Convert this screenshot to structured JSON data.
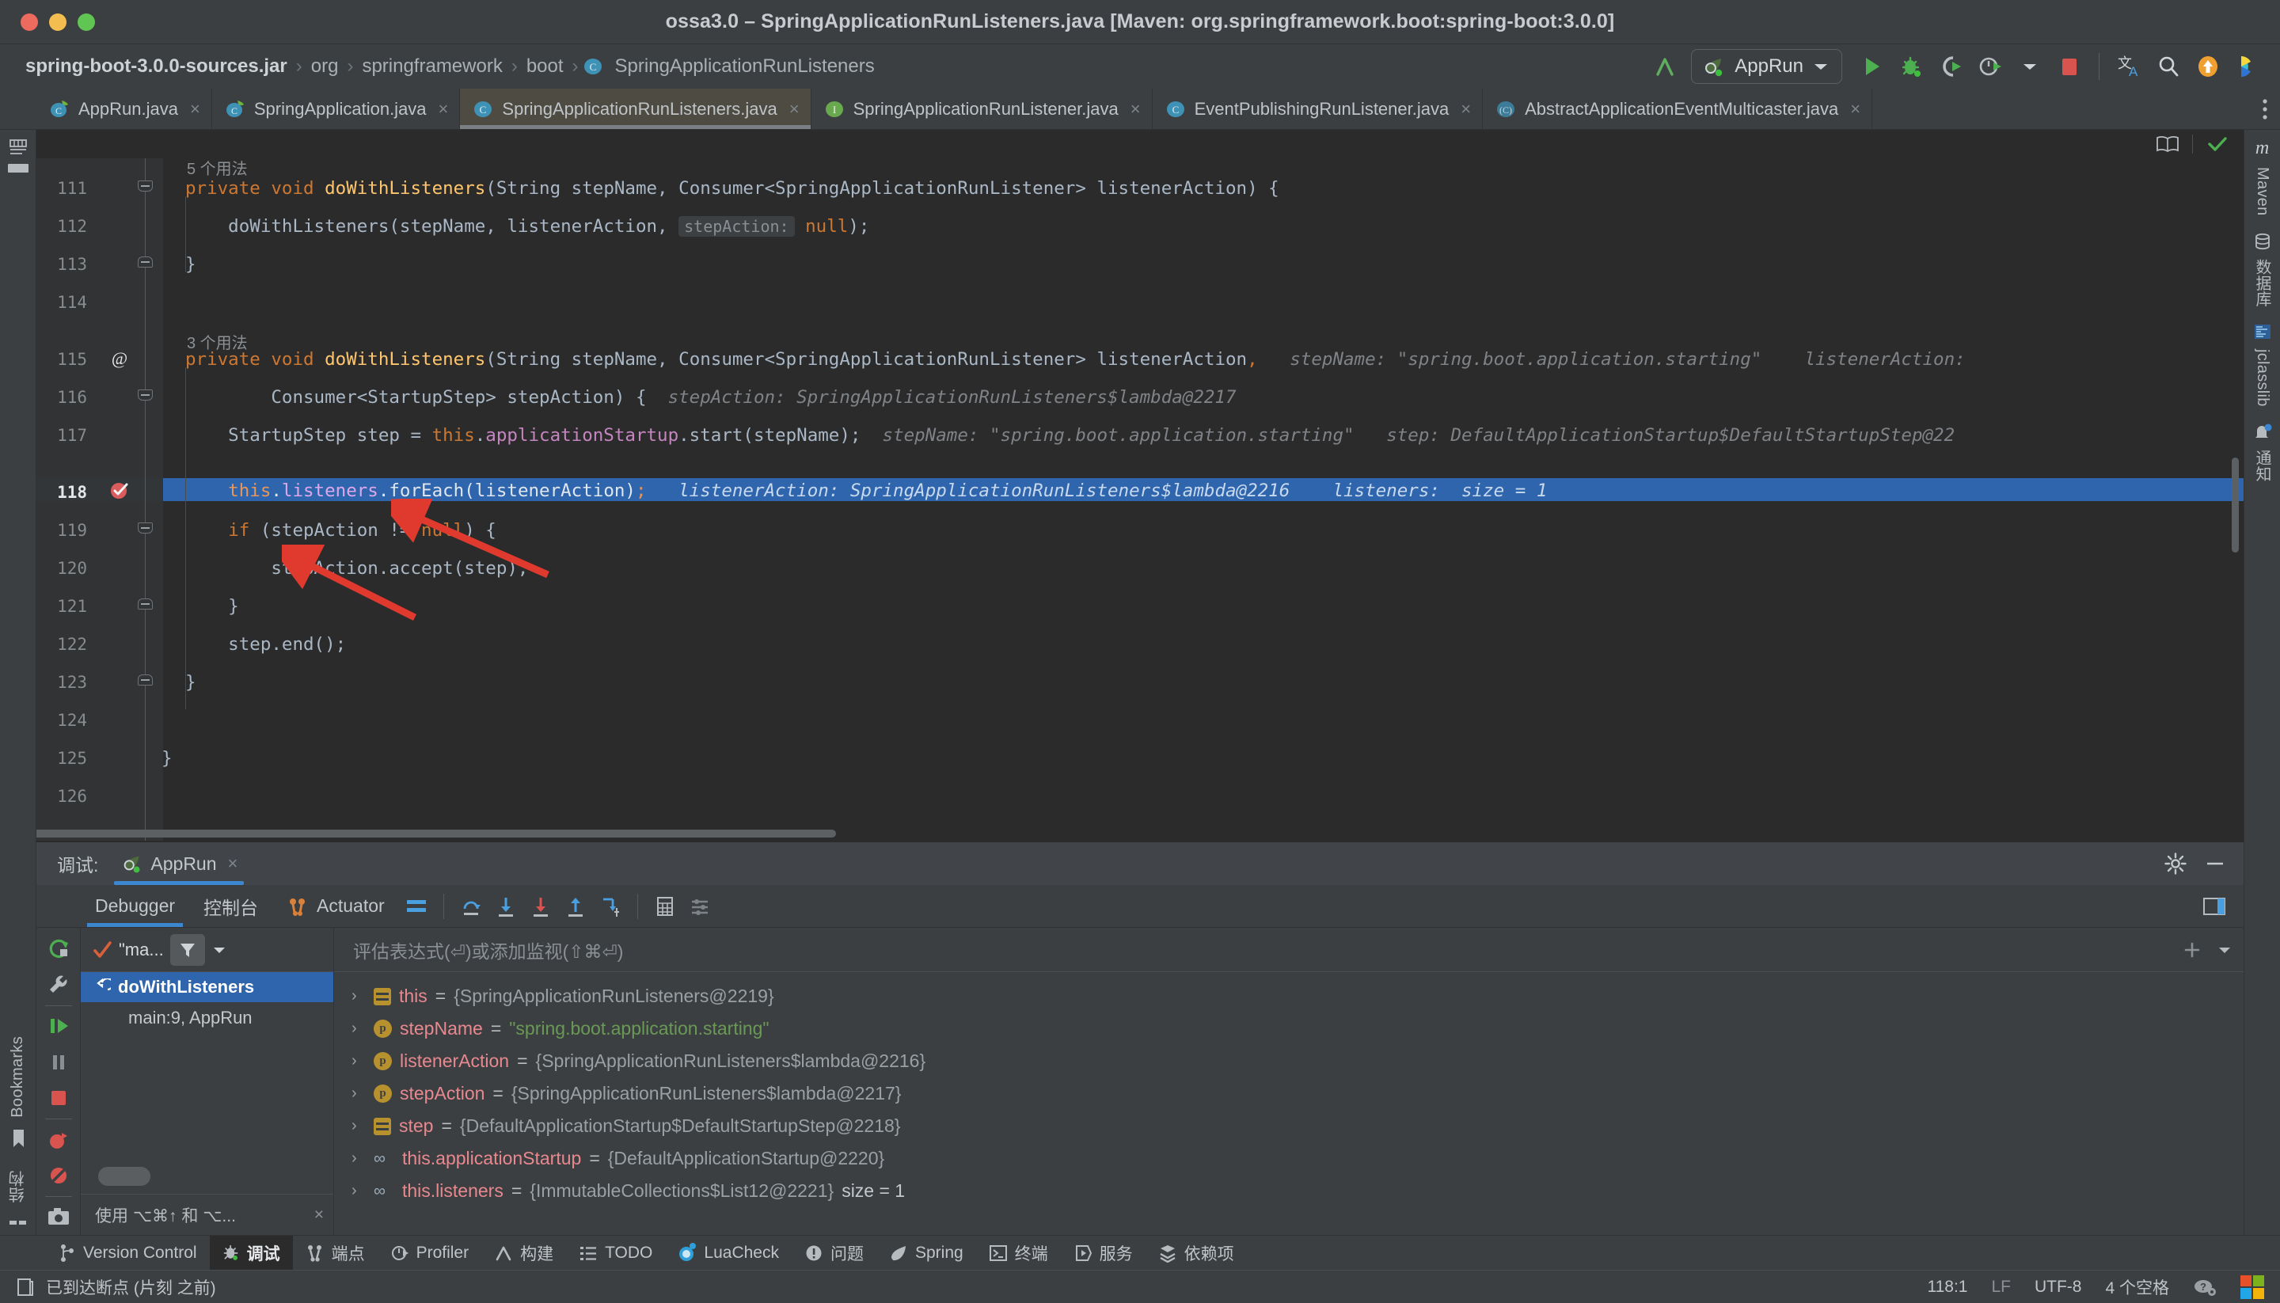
{
  "window": {
    "title": "ossa3.0 – SpringApplicationRunListeners.java [Maven: org.springframework.boot:spring-boot:3.0.0]",
    "traffic": [
      "close",
      "minimize",
      "zoom"
    ]
  },
  "breadcrumbs": [
    {
      "label": "spring-boot-3.0.0-sources.jar",
      "icon": ""
    },
    {
      "label": "org",
      "icon": ""
    },
    {
      "label": "springframework",
      "icon": ""
    },
    {
      "label": "boot",
      "icon": ""
    },
    {
      "label": "SpringApplicationRunListeners",
      "icon": "class-icon"
    }
  ],
  "toolbar": {
    "build_label": "build-icon",
    "run_config": "AppRun",
    "run_label": "run-icon",
    "debug_label": "debug-icon",
    "run_coverage_label": "run-with-coverage-icon",
    "profiler_label": "profiler-icon",
    "stop_label": "stop-icon",
    "translate_label": "translate-icon",
    "search_label": "search-everywhere-icon",
    "update_label": "update-icon",
    "ai_label": "ai-assistant-icon"
  },
  "tabs": [
    {
      "label": "AppRun.java",
      "icon": "spring-class-icon",
      "active": false
    },
    {
      "label": "SpringApplication.java",
      "icon": "class-icon",
      "active": false
    },
    {
      "label": "SpringApplicationRunListeners.java",
      "icon": "class-icon",
      "active": true
    },
    {
      "label": "SpringApplicationRunListener.java",
      "icon": "interface-icon",
      "active": false
    },
    {
      "label": "EventPublishingRunListener.java",
      "icon": "class-icon",
      "active": false
    },
    {
      "label": "AbstractApplicationEventMulticaster.java",
      "icon": "abstract-class-icon",
      "active": false
    }
  ],
  "left_toolwindows": [
    {
      "label": "项目",
      "icon": "project-icon"
    },
    {
      "label": "Bookmarks",
      "icon": "bookmarks-icon"
    },
    {
      "label": "结构",
      "icon": "structure-icon"
    }
  ],
  "right_toolwindows": [
    {
      "label": "Maven",
      "icon": "maven-icon"
    },
    {
      "label": "数据库",
      "icon": "database-icon"
    },
    {
      "label": "jclasslib",
      "icon": "jclasslib-icon"
    },
    {
      "label": "通知",
      "icon": "notifications-icon"
    }
  ],
  "editor": {
    "reader_mode_icon": "reader-mode-icon",
    "inspections_icon": "inspections-ok-icon",
    "usages_5": "5 个用法",
    "usages_3": "3 个用法",
    "line_numbers": [
      "111",
      "112",
      "113",
      "114",
      "115",
      "116",
      "117",
      "118",
      "119",
      "120",
      "121",
      "122",
      "123",
      "124",
      "125",
      "126"
    ],
    "current_line": "118",
    "lines": {
      "l111": "private void doWithListeners(String stepName, Consumer<SpringApplicationRunListener> listenerAction) {",
      "l112": "doWithListeners(stepName, listenerAction, stepAction: null);",
      "l112_hint": "stepAction:",
      "l113": "}",
      "l115": "private void doWithListeners(String stepName, Consumer<SpringApplicationRunListener> listenerAction,",
      "l115_hint1": "stepName:",
      "l115_hint1val": "\"spring.boot.application.starting\"",
      "l115_hint2": "listenerAction:",
      "l116": "Consumer<StartupStep> stepAction) {",
      "l116_hint": "stepAction: SpringApplicationRunListeners$lambda@2217",
      "l117": "StartupStep step = this.applicationStartup.start(stepName);",
      "l117_hint1": "stepName: \"spring.boot.application.starting\"",
      "l117_hint2": "step: DefaultApplicationStartup$DefaultStartupStep@22",
      "l118": "this.listeners.forEach(listenerAction);",
      "l118_hint1": "listenerAction:",
      "l118_hint1val": "SpringApplicationRunListeners$lambda@2216",
      "l118_hint2": "listeners:",
      "l118_hint2val": "size = 1",
      "l119": "if (stepAction != null) {",
      "l120": "stepAction.accept(step);",
      "l121": "}",
      "l122": "step.end();",
      "l123": "}",
      "l125": "}"
    }
  },
  "debug_panel": {
    "title": "调试:",
    "session_tab": "AppRun",
    "session_close": "×",
    "settings_icon": "gear-icon",
    "minimize_icon": "minimize-icon",
    "tabs": [
      {
        "label": "Debugger",
        "selected": true
      },
      {
        "label": "控制台",
        "selected": false
      },
      {
        "label": "Actuator",
        "selected": false,
        "icon": "actuator-icon"
      }
    ],
    "toolbar_icons": [
      "layout-icon",
      "step-over-icon",
      "step-into-icon",
      "force-step-into-icon",
      "step-out-icon",
      "run-to-cursor-icon",
      "evaluate-icon",
      "settings-icon"
    ],
    "side_icons": [
      "rerun-icon",
      "settings-wrench-icon",
      "resume-icon",
      "pause-icon",
      "stop-icon",
      "view-breakpoints-icon",
      "mute-breakpoints-icon",
      "screenshot-icon"
    ],
    "thread": "\"ma...",
    "filter_icon": "filter-icon",
    "frames": [
      {
        "label": "doWithListeners",
        "selected": true,
        "icon": "frame-icon"
      },
      {
        "label": "main:9, AppRun",
        "selected": false
      }
    ],
    "frames_hint": "使用 ⌥⌘↑ 和 ⌥...",
    "frames_hint_close": "×",
    "evaluate_placeholder": "评估表达式(⏎)或添加监视(⇧⌘⏎)",
    "variables": [
      {
        "icon": "field-icon",
        "name": "this",
        "value": "{SpringApplicationRunListeners@2219}",
        "type": "obj"
      },
      {
        "icon": "param-icon",
        "name": "stepName",
        "value": "\"spring.boot.application.starting\"",
        "type": "str"
      },
      {
        "icon": "param-icon",
        "name": "listenerAction",
        "value": "{SpringApplicationRunListeners$lambda@2216}",
        "type": "obj"
      },
      {
        "icon": "param-icon",
        "name": "stepAction",
        "value": "{SpringApplicationRunListeners$lambda@2217}",
        "type": "obj"
      },
      {
        "icon": "field-icon",
        "name": "step",
        "value": "{DefaultApplicationStartup$DefaultStartupStep@2218}",
        "type": "obj"
      },
      {
        "icon": "chain-icon",
        "name": "this.applicationStartup",
        "value": "{DefaultApplicationStartup@2220}",
        "type": "obj"
      },
      {
        "icon": "chain-icon",
        "name": "this.listeners",
        "value": "{ImmutableCollections$List12@2221}",
        "extra": "size = 1",
        "type": "obj"
      }
    ]
  },
  "tool_window_bar": [
    {
      "label": "Version Control",
      "icon": "vcs-icon",
      "selected": false
    },
    {
      "label": "调试",
      "icon": "debug-icon",
      "selected": true
    },
    {
      "label": "端点",
      "icon": "endpoints-icon",
      "selected": false
    },
    {
      "label": "Profiler",
      "icon": "profiler-icon",
      "selected": false
    },
    {
      "label": "构建",
      "icon": "build-icon",
      "selected": false
    },
    {
      "label": "TODO",
      "icon": "todo-icon",
      "selected": false
    },
    {
      "label": "LuaCheck",
      "icon": "luacheck-icon",
      "selected": false
    },
    {
      "label": "问题",
      "icon": "problems-icon",
      "selected": false
    },
    {
      "label": "Spring",
      "icon": "spring-icon",
      "selected": false
    },
    {
      "label": "终端",
      "icon": "terminal-icon",
      "selected": false
    },
    {
      "label": "服务",
      "icon": "services-icon",
      "selected": false
    },
    {
      "label": "依赖项",
      "icon": "dependencies-icon",
      "selected": false
    }
  ],
  "status_bar": {
    "icon": "memory-icon",
    "message": "已到达断点 (片刻 之前)",
    "caret": "118:1",
    "line_sep": "LF",
    "encoding": "UTF-8",
    "indent": "4 个空格",
    "help_icon": "help-icon",
    "os_icon": "windows-icon"
  },
  "colors": {
    "accent_blue": "#2f65ad",
    "selection_blue": "#3d86d0",
    "editor_bg": "#2b2b2b",
    "panel_bg": "#3c3f41",
    "keyword_orange": "#cc7832",
    "string_green": "#6a8759",
    "method_yellow": "#ffc66d",
    "field_purple": "#c586c0",
    "breakpoint_red": "#db5c5c",
    "arrow_red": "#e03a2f"
  }
}
